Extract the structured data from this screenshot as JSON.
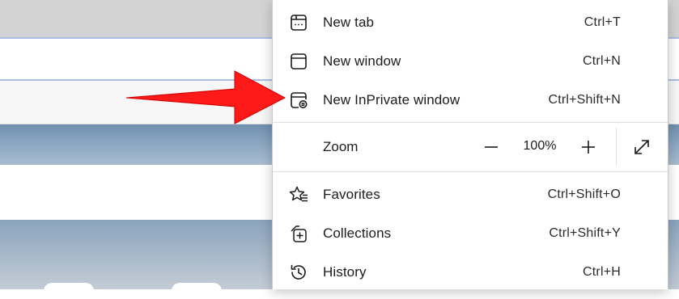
{
  "menu": {
    "items_top": [
      {
        "label": "New tab",
        "shortcut": "Ctrl+T",
        "icon": "new-tab-icon"
      },
      {
        "label": "New window",
        "shortcut": "Ctrl+N",
        "icon": "new-window-icon"
      },
      {
        "label": "New InPrivate window",
        "shortcut": "Ctrl+Shift+N",
        "icon": "inprivate-window-icon"
      }
    ],
    "zoom": {
      "label": "Zoom",
      "value": "100%",
      "decrease_icon": "minus-icon",
      "increase_icon": "plus-icon",
      "fullscreen_icon": "fullscreen-expand-icon"
    },
    "items_bottom": [
      {
        "label": "Favorites",
        "shortcut": "Ctrl+Shift+O",
        "icon": "favorites-icon"
      },
      {
        "label": "Collections",
        "shortcut": "Ctrl+Shift+Y",
        "icon": "collections-icon"
      },
      {
        "label": "History",
        "shortcut": "Ctrl+H",
        "icon": "history-icon"
      }
    ]
  },
  "annotation": {
    "arrow_color": "#ff1a1a",
    "points_to": "New InPrivate window"
  },
  "colors": {
    "menu_background": "#ffffff",
    "text": "#1b1b1b",
    "divider": "#dedede"
  }
}
